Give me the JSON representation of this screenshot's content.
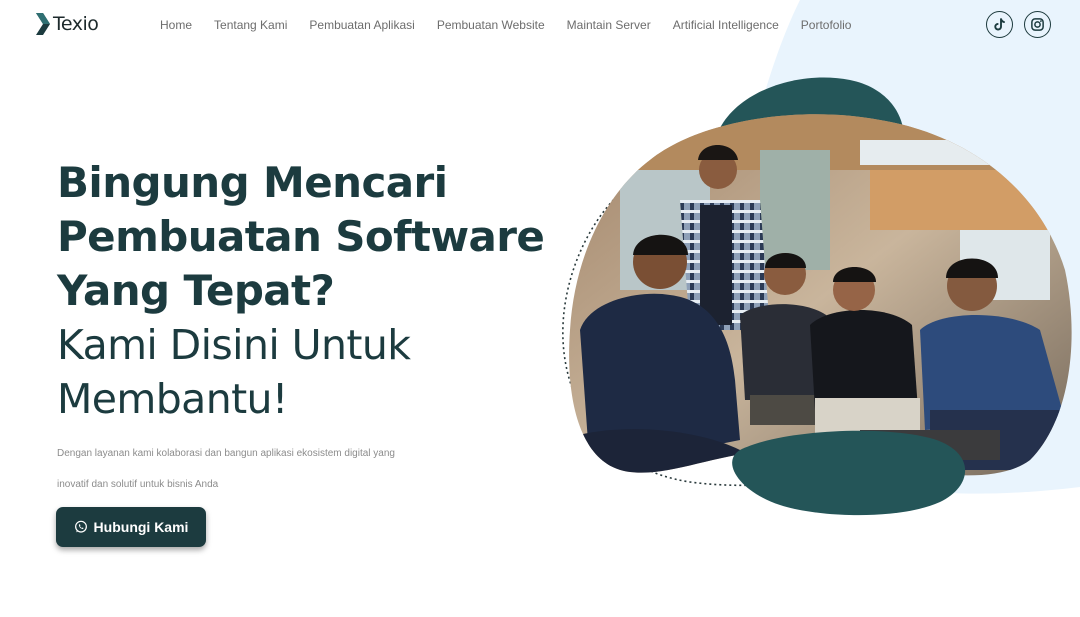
{
  "brand": {
    "name": "Texio",
    "accent": "#1c3b3f",
    "teal": "#245558",
    "blob_blue": "#e9f4fd"
  },
  "nav": {
    "items": [
      {
        "label": "Home"
      },
      {
        "label": "Tentang Kami"
      },
      {
        "label": "Pembuatan Aplikasi"
      },
      {
        "label": "Pembuatan Website"
      },
      {
        "label": "Maintain Server"
      },
      {
        "label": "Artificial Intelligence"
      },
      {
        "label": "Portofolio"
      }
    ]
  },
  "social": [
    {
      "icon": "tiktok-icon"
    },
    {
      "icon": "instagram-icon"
    }
  ],
  "hero": {
    "line1": "Bingung Mencari",
    "line2": "Pembuatan Software",
    "line3": "Yang Tepat?",
    "line4": "Kami Disini Untuk",
    "line5": "Membantu!",
    "description_line1": "Dengan layanan kami kolaborasi dan bangun aplikasi ekosistem digital yang",
    "description_line2": "inovatif dan solutif untuk bisnis Anda",
    "cta_label": "Hubungi Kami",
    "cta_icon": "whatsapp-icon"
  }
}
